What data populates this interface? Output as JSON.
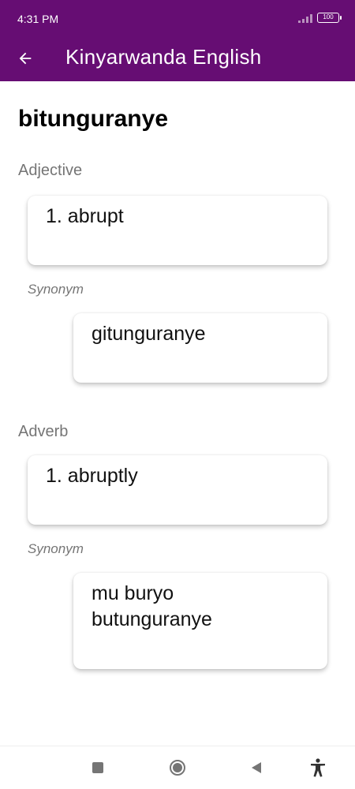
{
  "status": {
    "time": "4:31 PM",
    "battery": "100"
  },
  "appbar": {
    "title": "Kinyarwanda English"
  },
  "entry": {
    "word": "bitunguranye",
    "sections": [
      {
        "part_of_speech": "Adjective",
        "definition": "1. abrupt",
        "synonym_label": "Synonym",
        "synonym": "gitunguranye"
      },
      {
        "part_of_speech": "Adverb",
        "definition": "1. abruptly",
        "synonym_label": "Synonym",
        "synonym": "mu buryo butunguranye"
      }
    ]
  },
  "colors": {
    "app_bar": "#660d73",
    "background": "#ffffff",
    "secondary_text": "#757575"
  },
  "icons": {
    "back": "arrow-left-icon",
    "nav": [
      "square-recent-icon",
      "circle-home-icon",
      "triangle-back-icon",
      "accessibility-icon"
    ]
  }
}
